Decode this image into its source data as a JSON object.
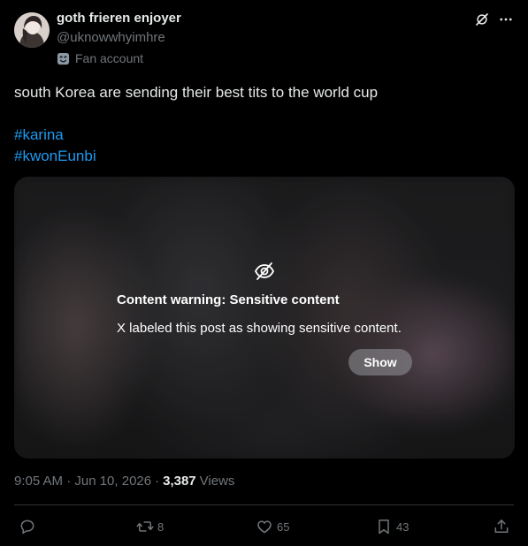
{
  "author": {
    "display_name": "goth frieren enjoyer",
    "handle": "@uknowwhyimhre",
    "affiliation": "Fan account"
  },
  "post": {
    "text": "south Korea are sending their best tits to the world cup",
    "hashtags": [
      "#karina",
      "#kwonEunbi"
    ]
  },
  "media": {
    "warning_title": "Content warning: Sensitive content",
    "warning_body": "X labeled this post as showing sensitive content.",
    "show_label": "Show"
  },
  "meta": {
    "timestamp": "9:05 AM · Jun 10, 2026",
    "views_count": "3,387",
    "views_label": "Views"
  },
  "actions": {
    "reply_count": "",
    "repost_count": "8",
    "like_count": "65",
    "bookmark_count": "43"
  },
  "icons": {
    "header": [
      "grok-icon",
      "more-icon"
    ],
    "affiliation": "mask-icon",
    "media": "eye-slash-icon",
    "actions": [
      "reply-icon",
      "repost-icon",
      "like-icon",
      "bookmark-icon",
      "share-icon"
    ]
  },
  "colors": {
    "background": "#000000",
    "text": "#e7e9ea",
    "secondary_text": "#71767b",
    "link": "#1d9bf0",
    "divider": "#2f3336"
  }
}
